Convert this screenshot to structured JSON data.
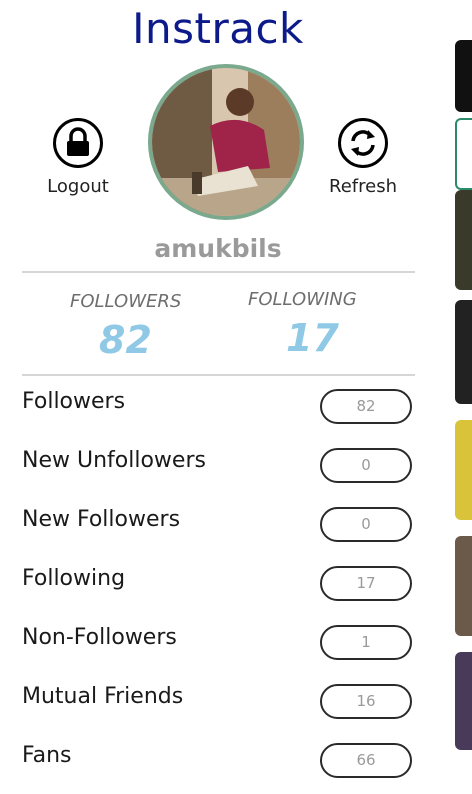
{
  "app": {
    "title": "Instrack"
  },
  "actions": {
    "logout_label": "Logout",
    "refresh_label": "Refresh"
  },
  "profile": {
    "username": "amukbils"
  },
  "stats": {
    "followers_caption": "FOLLOWERS",
    "followers_value": "82",
    "following_caption": "FOLLOWING",
    "following_value": "17"
  },
  "rows": [
    {
      "label": "Followers",
      "value": "82"
    },
    {
      "label": "New Unfollowers",
      "value": "0"
    },
    {
      "label": "New Followers",
      "value": "0"
    },
    {
      "label": "Following",
      "value": "17"
    },
    {
      "label": "Non-Followers",
      "value": "1"
    },
    {
      "label": "Mutual Friends",
      "value": "16"
    },
    {
      "label": "Fans",
      "value": "66"
    }
  ],
  "icons": {
    "logout": "lock-icon",
    "refresh": "refresh-icon"
  },
  "colors": {
    "title": "#0c1a8a",
    "avatar_ring": "#7aa98e",
    "stat_number": "#8fc9e5",
    "username": "#9a9a9a"
  }
}
